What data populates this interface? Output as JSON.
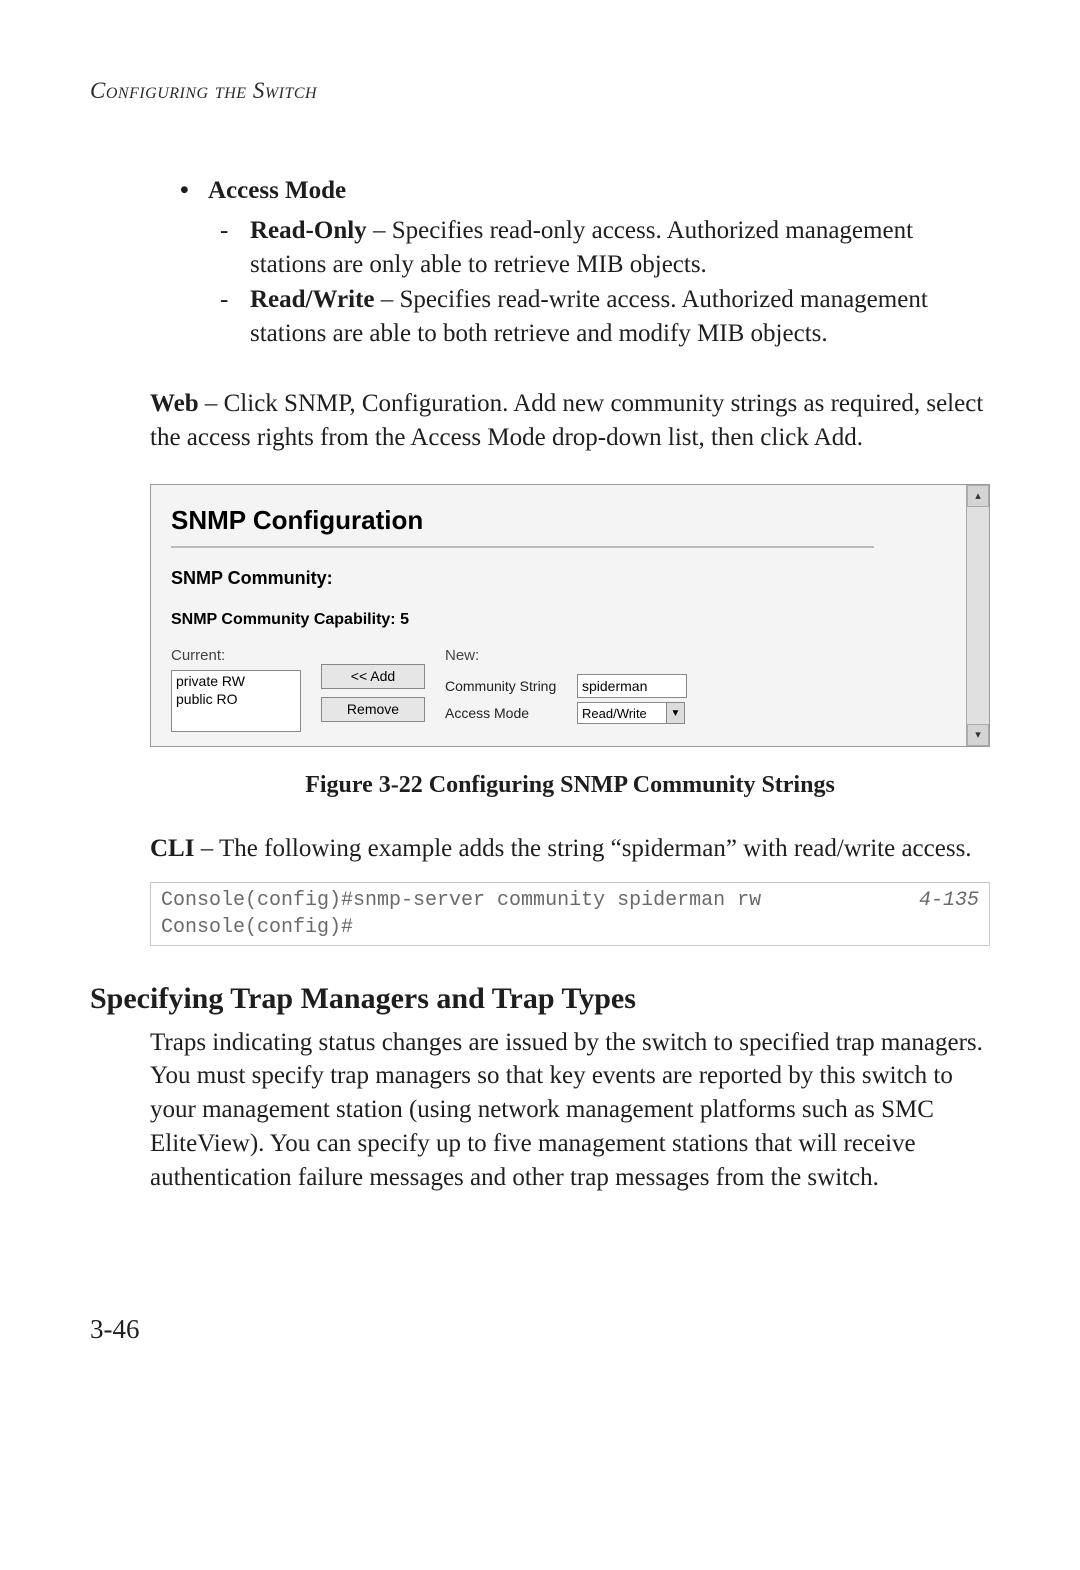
{
  "running_head": "Configuring the Switch",
  "bullet_title": "Access Mode",
  "sub1_term": "Read-Only",
  "sub1_rest": " – Specifies read-only access. Authorized management stations are only able to retrieve MIB objects.",
  "sub2_term": "Read/Write",
  "sub2_rest": " – Specifies read-write access. Authorized management stations are able to both retrieve and modify MIB objects.",
  "web_term": "Web",
  "web_rest": " – Click SNMP, Configuration. Add new community strings as required, select the access rights from the Access Mode drop-down list, then click Add.",
  "ui": {
    "title": "SNMP Configuration",
    "subtitle": "SNMP Community:",
    "capability": "SNMP Community Capability: 5",
    "current_label": "Current:",
    "new_label": "New:",
    "list_items": [
      "private RW",
      "public RO"
    ],
    "add_btn": "<< Add",
    "remove_btn": "Remove",
    "community_label": "Community String",
    "community_value": "spiderman",
    "access_label": "Access Mode",
    "access_value": "Read/Write"
  },
  "figure_caption": "Figure 3-22  Configuring SNMP Community Strings",
  "cli_term": "CLI",
  "cli_rest": " – The following example adds the string “spiderman” with read/write access.",
  "cli_code": "Console(config)#snmp-server community spiderman rw\nConsole(config)#",
  "cli_ref": "4-135",
  "section_heading": "Specifying Trap Managers and Trap Types",
  "section_body": "Traps indicating status changes are issued by the switch to specified trap managers. You must specify trap managers so that key events are reported by this switch to your management station (using network management platforms such as SMC EliteView). You can specify up to five management stations that will receive authentication failure messages and other trap messages from the switch.",
  "page_number": "3-46"
}
